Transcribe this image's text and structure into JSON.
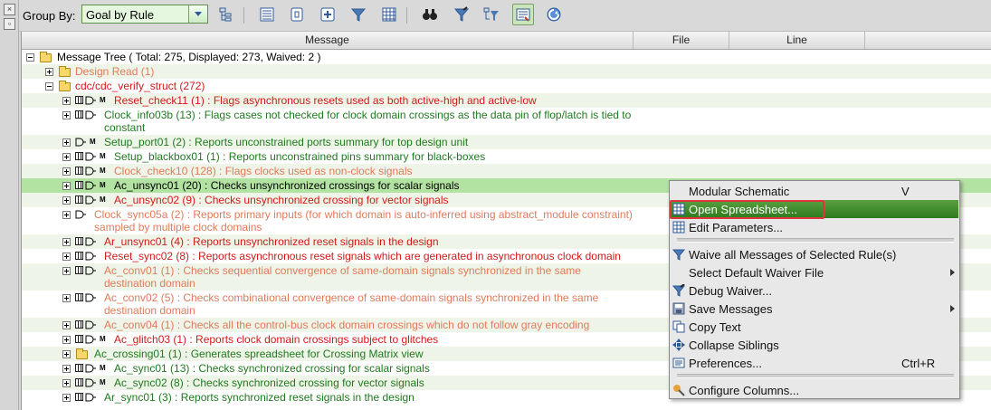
{
  "toolbar": {
    "group_by_label": "Group By:",
    "group_by_value": "Goal by Rule",
    "icons": [
      "hierarchy-icon",
      "list-view-icon",
      "schematic-icon",
      "add-icon",
      "filter-icon",
      "spreadsheet-icon",
      "binoculars-icon",
      "filter-edit-icon",
      "tree-filter-icon",
      "waiver-active-icon",
      "refresh-icon"
    ]
  },
  "columns": [
    "Message",
    "File",
    "Line"
  ],
  "tree": {
    "root": "Message Tree ( Total: 275, Displayed: 273, Waived: 2 )",
    "items": [
      {
        "text": "Design Read (1)",
        "color": "salmon"
      },
      {
        "text": "cdc/cdc_verify_struct (272)",
        "color": "red"
      },
      {
        "text": "Reset_check11 (1) : Flags asynchronous resets used as both active-high and active-low",
        "color": "red"
      },
      {
        "text": "Clock_info03b (13) : Flags cases not checked for clock domain crossings as the data pin of flop/latch is tied to constant",
        "color": "green"
      },
      {
        "text": "Setup_port01 (2) : Reports unconstrained ports summary for top design unit",
        "color": "green"
      },
      {
        "text": "Setup_blackbox01 (1) : Reports unconstrained pins summary for black-boxes",
        "color": "green"
      },
      {
        "text": "Clock_check10 (128) : Flags clocks used as non-clock signals",
        "color": "salmon"
      },
      {
        "text": "Ac_unsync01 (20) : Checks unsynchronized crossings for scalar signals",
        "color": "black"
      },
      {
        "text": "Ac_unsync02 (9) : Checks unsynchronized crossing for vector signals",
        "color": "red"
      },
      {
        "text": "Clock_sync05a (2) : Reports primary inputs (for which domain is auto-inferred using abstract_module constraint) sampled by multiple clock domains",
        "color": "salmon"
      },
      {
        "text": "Ar_unsync01 (4) : Reports unsynchronized reset signals in the design",
        "color": "red"
      },
      {
        "text": "Reset_sync02 (8) : Reports asynchronous reset signals which are generated in asynchronous clock domain",
        "color": "red"
      },
      {
        "text": "Ac_conv01 (1) : Checks sequential convergence of same-domain signals synchronized in the same destination domain",
        "color": "salmon"
      },
      {
        "text": "Ac_conv02 (5) : Checks combinational convergence of same-domain signals synchronized in the same destination domain",
        "color": "salmon"
      },
      {
        "text": "Ac_conv04 (1) : Checks all the control-bus clock domain crossings which do not follow gray encoding",
        "color": "salmon"
      },
      {
        "text": "Ac_glitch03 (1) : Reports clock domain crossings subject to glitches",
        "color": "red"
      },
      {
        "text": "Ac_crossing01 (1) : Generates spreadsheet for Crossing Matrix view",
        "color": "green"
      },
      {
        "text": "Ac_sync01 (13) : Checks synchronized crossing for scalar signals",
        "color": "green"
      },
      {
        "text": "Ac_sync02 (8) : Checks synchronized crossing for vector signals",
        "color": "green"
      },
      {
        "text": "Ar_sync01 (3) : Reports synchronized reset signals in the design",
        "color": "green"
      }
    ]
  },
  "context_menu": {
    "items": [
      {
        "label": "Modular Schematic",
        "shortcut": "V"
      },
      {
        "label": "Open Spreadsheet..."
      },
      {
        "label": "Edit Parameters..."
      },
      {
        "label": "Waive all Messages of Selected Rule(s)"
      },
      {
        "label": "Select Default Waiver File"
      },
      {
        "label": "Debug Waiver..."
      },
      {
        "label": "Save Messages"
      },
      {
        "label": "Copy Text"
      },
      {
        "label": "Collapse Siblings"
      },
      {
        "label": "Preferences...",
        "shortcut": "Ctrl+R"
      },
      {
        "label": "Configure Columns..."
      }
    ],
    "highlighted": "Open Spreadsheet..."
  }
}
